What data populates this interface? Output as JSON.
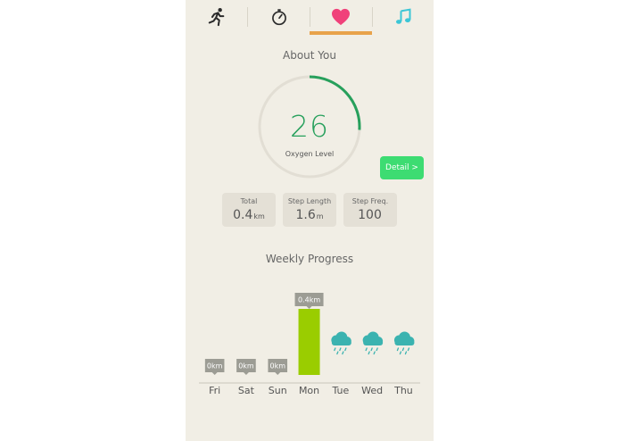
{
  "tabs": [
    {
      "icon": "runner-icon",
      "color": "#2b2b2b",
      "selected": false
    },
    {
      "icon": "stopwatch-icon",
      "color": "#2b2b2b",
      "selected": false
    },
    {
      "icon": "heart-icon",
      "color": "#f0417a",
      "selected": true
    },
    {
      "icon": "music-note-icon",
      "color": "#3cc6d6",
      "selected": false
    }
  ],
  "tab_accent_color": "#e8a24a",
  "section_title": "About You",
  "oxygen": {
    "value": "26",
    "label": "Oxygen Level",
    "fraction": 0.26,
    "arc_color": "#27a05c",
    "track_color": "#e2ded4"
  },
  "detail_button": {
    "label": "Detail >",
    "color": "#3ddc72"
  },
  "stats": [
    {
      "label": "Total",
      "value": "0.4",
      "unit": "km"
    },
    {
      "label": "Step Length",
      "value": "1.6",
      "unit": "m"
    },
    {
      "label": "Step Freq.",
      "value": "100",
      "unit": ""
    }
  ],
  "weekly_title": "Weekly Progress",
  "chart_data": {
    "type": "bar",
    "title": "Weekly Progress",
    "categories": [
      "Fri",
      "Sat",
      "Sun",
      "Mon",
      "Tue",
      "Wed",
      "Thu"
    ],
    "values": [
      0,
      0,
      0,
      0.4,
      null,
      null,
      null
    ],
    "data_labels": [
      "0km",
      "0km",
      "0km",
      "0.4km",
      "",
      "",
      ""
    ],
    "forecast": [
      "",
      "",
      "",
      "",
      "rain",
      "rain",
      "rain"
    ],
    "unit": "km",
    "bar_color": "#9acd00",
    "label_color": "#9c9c94",
    "weather_icon_color": "#3bb3b0",
    "grid": false
  }
}
